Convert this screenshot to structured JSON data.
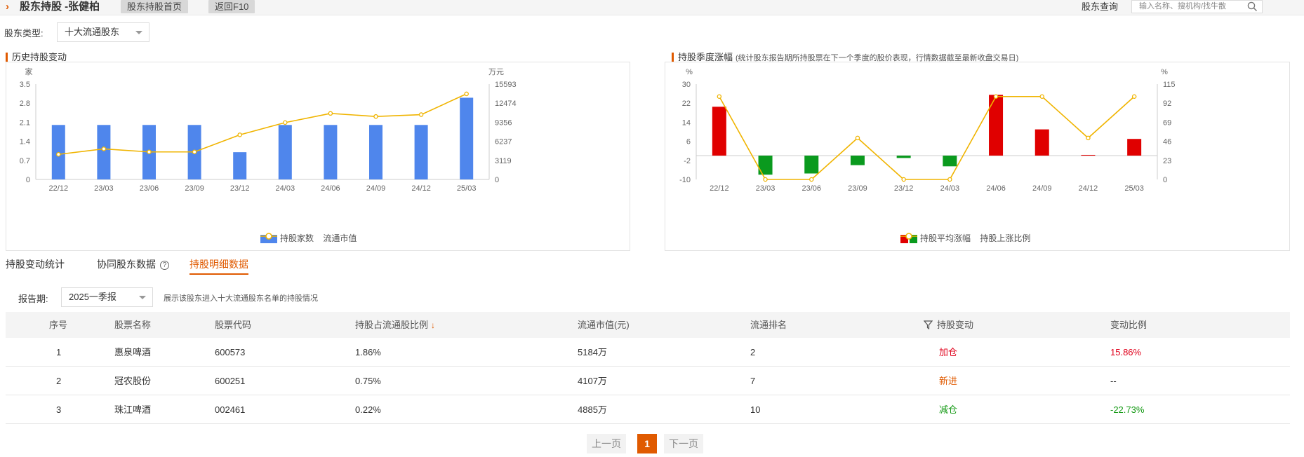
{
  "header": {
    "title": "股东持股 -张健柏",
    "btn_home": "股东持股首页",
    "btn_f10": "返回F10",
    "query_label": "股东查询",
    "search_placeholder": "输入名称、搜机构/找牛散"
  },
  "filter": {
    "type_label": "股东类型:",
    "type_value": "十大流通股东"
  },
  "chart1": {
    "title": "历史持股变动",
    "legend_bar": "持股家数",
    "legend_line": "流通市值"
  },
  "chart2": {
    "title": "持股季度涨幅",
    "note": "(统计股东报告期所持股票在下一个季度的股价表现，行情数据截至最新收盘交易日)",
    "legend_bar": "持股平均涨幅",
    "legend_line": "持股上涨比例"
  },
  "chart_data": [
    {
      "type": "bar",
      "title": "历史持股变动",
      "categories": [
        "22/12",
        "23/03",
        "23/06",
        "23/09",
        "23/12",
        "24/03",
        "24/06",
        "24/09",
        "24/12",
        "25/03"
      ],
      "y_left_unit": "家",
      "y_right_unit": "万元",
      "y_left_ticks": [
        "0",
        "0.7",
        "1.4",
        "2.1",
        "2.8",
        "3.5"
      ],
      "y_right_ticks": [
        "0",
        "3119",
        "6237",
        "9356",
        "12474",
        "15593"
      ],
      "ylim_left": [
        0,
        3.5
      ],
      "ylim_right": [
        0,
        15593
      ],
      "series": [
        {
          "name": "持股家数",
          "kind": "bar",
          "axis": "left",
          "color": "#4f86ec",
          "values": [
            2,
            2,
            2,
            2,
            1,
            2,
            2,
            2,
            2,
            3
          ]
        },
        {
          "name": "流通市值",
          "kind": "line",
          "axis": "right",
          "color": "#f0b400",
          "values": [
            4100,
            5000,
            4500,
            4500,
            7300,
            9300,
            10800,
            10300,
            10600,
            14000
          ]
        }
      ]
    },
    {
      "type": "bar",
      "title": "持股季度涨幅",
      "categories": [
        "22/12",
        "23/03",
        "23/06",
        "23/09",
        "23/12",
        "24/03",
        "24/06",
        "24/09",
        "24/12",
        "25/03"
      ],
      "y_left_unit": "%",
      "y_right_unit": "%",
      "y_left_ticks": [
        "-10",
        "-2",
        "6",
        "14",
        "22",
        "30"
      ],
      "y_right_ticks": [
        "0",
        "23",
        "46",
        "69",
        "92",
        "115"
      ],
      "ylim_left": [
        -10,
        30
      ],
      "ylim_right": [
        0,
        115
      ],
      "series": [
        {
          "name": "持股平均涨幅",
          "kind": "bar",
          "axis": "left",
          "color_pos": "#e00000",
          "color_neg": "#0a9a1e",
          "values": [
            20.5,
            -8,
            -7.5,
            -4,
            -1,
            -4.5,
            25.5,
            11,
            0.3,
            7
          ]
        },
        {
          "name": "持股上涨比例",
          "kind": "line",
          "axis": "right",
          "color": "#f0b400",
          "values": [
            100,
            0,
            0,
            50,
            0,
            0,
            100,
            100,
            50,
            100
          ]
        }
      ]
    }
  ],
  "tabs": [
    "持股变动统计",
    "协同股东数据",
    "持股明细数据"
  ],
  "help_glyph": "?",
  "period": {
    "label": "报告期:",
    "value": "2025一季报",
    "hint": "展示该股东进入十大流通股东名单的持股情况"
  },
  "table": {
    "headers": [
      "序号",
      "股票名称",
      "股票代码",
      "持股占流通股比例",
      "流通市值(元)",
      "流通排名",
      "持股变动",
      "变动比例"
    ],
    "rows": [
      [
        "1",
        "惠泉啤酒",
        "600573",
        "1.86%",
        "5184万",
        "2",
        "加仓",
        "15.86%"
      ],
      [
        "2",
        "冠农股份",
        "600251",
        "0.75%",
        "4107万",
        "7",
        "新进",
        "--"
      ],
      [
        "3",
        "珠江啤酒",
        "002461",
        "0.22%",
        "4885万",
        "10",
        "减仓",
        "-22.73%"
      ]
    ]
  },
  "pager": {
    "prev": "上一页",
    "current": "1",
    "next": "下一页"
  },
  "colors": {
    "accent": "#e05a00",
    "bar_blue": "#4f86ec",
    "line_gold": "#f0b400",
    "up_red": "#e0001b",
    "down_green": "#159a15"
  }
}
